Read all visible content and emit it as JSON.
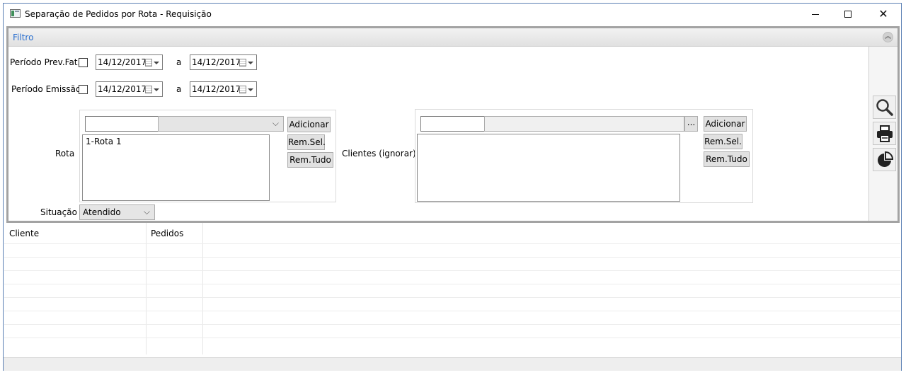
{
  "window": {
    "title": "Separação de Pedidos por Rota - Requisição",
    "controls": {
      "minimize": "minimize-icon",
      "maximize": "maximize-icon",
      "close": "close-icon"
    }
  },
  "filter": {
    "title": "Filtro",
    "periodo_prev_fat": {
      "label": "Período Prev.Fat.",
      "checked": false,
      "from": "14/12/2017",
      "sep": "a",
      "to": "14/12/2017"
    },
    "periodo_emissao": {
      "label": "Período Emissão",
      "checked": false,
      "from": "14/12/2017",
      "sep": "a",
      "to": "14/12/2017"
    },
    "rota": {
      "label": "Rota",
      "code_value": "",
      "selected_value": "",
      "items": [
        "1-Rota 1"
      ],
      "add_label": "Adicionar",
      "remove_selected_label": "Rem.Sel.",
      "remove_all_label": "Rem.Tudo"
    },
    "clientes": {
      "label": "Clientes (ignorar)",
      "code_value": "",
      "name_value": "",
      "lookup_label": "...",
      "items": [],
      "add_label": "Adicionar",
      "remove_selected_label": "Rem.Sel.",
      "remove_all_label": "Rem.Tudo"
    },
    "situacao": {
      "label": "Situação",
      "value": "Atendido"
    }
  },
  "toolbar": {
    "search_icon": "search-icon",
    "print_icon": "printer-icon",
    "chart_icon": "pie-chart-icon"
  },
  "grid": {
    "columns": [
      "Cliente",
      "Pedidos"
    ],
    "rows": []
  },
  "colors": {
    "accent": "#2a6fcf",
    "panel_border": "#a3a3a3",
    "window_border": "#5a7fb3"
  }
}
